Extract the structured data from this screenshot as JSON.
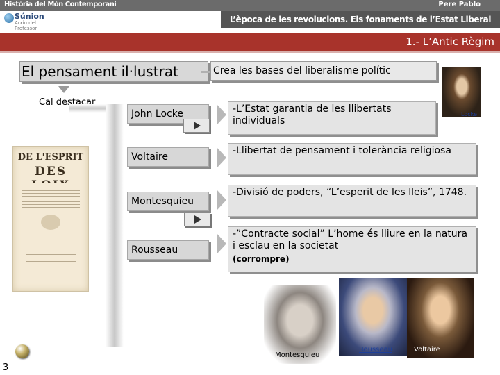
{
  "header": {
    "course_title": "Història del Món Contemporani",
    "author": "Pere Pablo",
    "logo_name": "Súnion",
    "logo_sub": "Arxiu del Professor",
    "subtitle": "L’època de les revolucions. Els fonaments de l’Estat Liberal"
  },
  "section_title": "1.- L’Antic Règim",
  "heading": "El pensament il·lustrat",
  "liberalism": "Crea les bases del liberalisme polític",
  "cal_destacar": "Cal destacar",
  "book": {
    "line1": "DE L'ESPRIT",
    "line2": "DES LOIX"
  },
  "thinkers": [
    {
      "name": "John Locke",
      "desc": "-L’Estat garantia de les llibertats individuals"
    },
    {
      "name": "Voltaire",
      "desc": "-Llibertat de pensament i tolerància religiosa"
    },
    {
      "name": "Montesquieu",
      "desc": "-Divisió de poders, “L’esperit de les lleis”, 1748."
    },
    {
      "name": "Rousseau",
      "desc": "-”Contracte social” L’home és lliure en la natura i esclau en la societat",
      "note": "(corrompre)"
    }
  ],
  "portraits": {
    "locke": "Locke",
    "montesquieu": "Montesquieu",
    "rousseau": "Rousseau",
    "voltaire": "Voltaire"
  },
  "page_number": "3",
  "colors": {
    "accent": "#a8332b",
    "top_bar": "#6b6b6b",
    "link": "#1d3f9a"
  }
}
